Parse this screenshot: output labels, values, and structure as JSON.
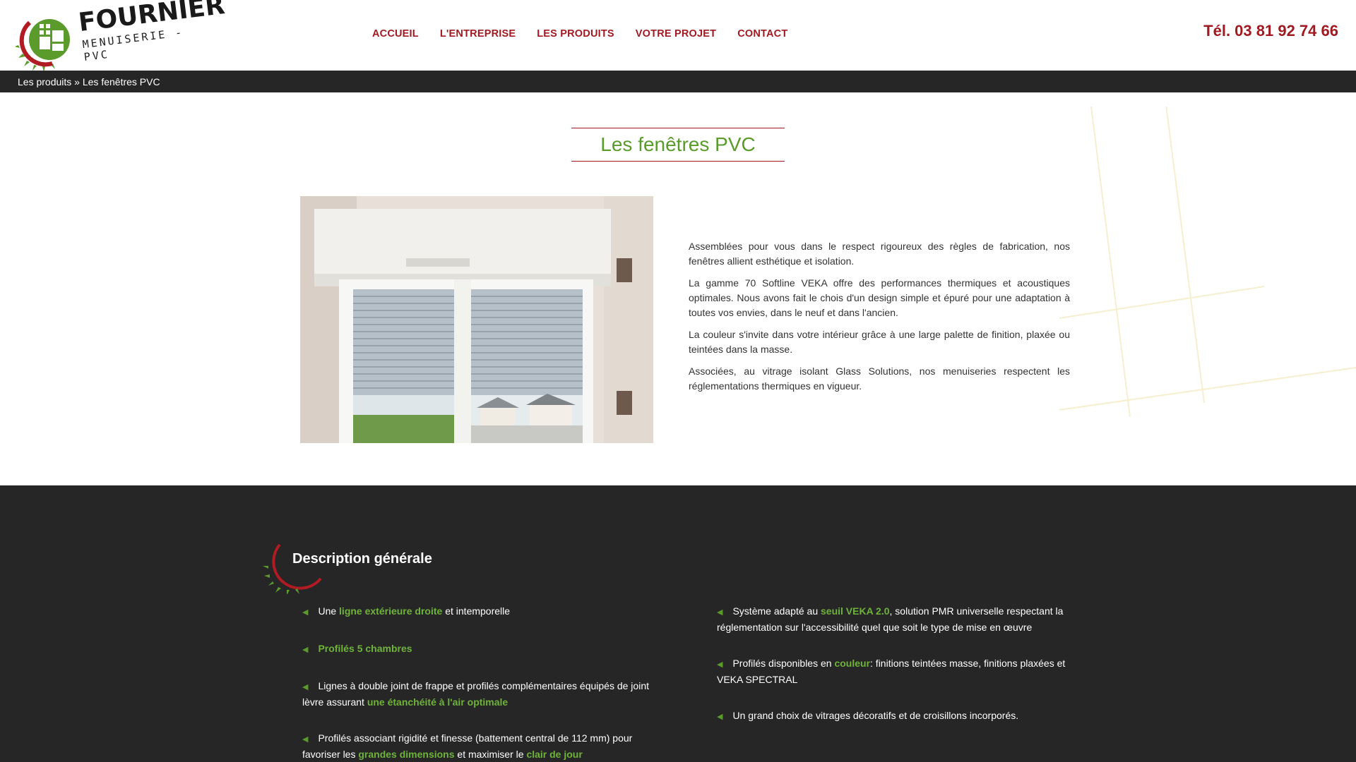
{
  "brand": {
    "name": "FOURNIER",
    "sub": "MENUISERIE - PVC"
  },
  "nav": {
    "items": [
      {
        "label": "ACCUEIL"
      },
      {
        "label": "L'ENTREPRISE"
      },
      {
        "label": "LES PRODUITS"
      },
      {
        "label": "VOTRE PROJET"
      },
      {
        "label": "CONTACT"
      }
    ]
  },
  "phone": "Tél. 03 81 92 74 66",
  "breadcrumb": {
    "parent": "Les produits",
    "separator": " » ",
    "current": "Les fenêtres PVC"
  },
  "page": {
    "title": "Les fenêtres PVC",
    "photo_icon": "window-with-roller-shutters-photo",
    "paragraphs": [
      "Assemblées pour vous dans le respect rigoureux des règles de fabrication, nos fenêtres allient esthétique et isolation.",
      "La gamme 70 Softline VEKA offre des performances thermiques et acoustiques optimales. Nous avons fait le chois d'un design simple et épuré pour une adaptation à toutes vos envies, dans le neuf et dans l'ancien.",
      "La couleur s'invite dans votre intérieur grâce à une large palette de finition, plaxée ou teintées dans la masse.",
      "Associées, au vitrage isolant Glass Solutions, nos menuiseries respectent les réglementations thermiques en vigueur."
    ]
  },
  "description": {
    "title": "Description générale",
    "bullet_icon": "triangle-left-icon",
    "left": [
      {
        "before": "Une ",
        "highlight": "ligne extérieure droite",
        "after": " et intemporelle",
        "highlight2": "",
        "after2": ""
      },
      {
        "before": "",
        "highlight": "Profilés 5 chambres",
        "after": "",
        "highlight2": "",
        "after2": ""
      },
      {
        "before": "Lignes à double joint de frappe et profilés complémentaires équipés de joint lèvre assurant ",
        "highlight": "une étanchéité à l'air optimale",
        "after": "",
        "highlight2": "",
        "after2": ""
      },
      {
        "before": "Profilés associant rigidité et finesse (battement central de 112 mm) pour favoriser les ",
        "highlight": "grandes dimensions",
        "after": " et maximiser le ",
        "highlight2": "clair de jour",
        "after2": ""
      }
    ],
    "right": [
      {
        "before": "Système adapté au ",
        "highlight": "seuil VEKA 2.0",
        "after": ", solution PMR universelle respectant la réglementation sur l'accessibilité quel que soit le type de mise en œuvre",
        "highlight2": "",
        "after2": ""
      },
      {
        "before": "Profilés disponibles en ",
        "highlight": "couleur",
        "after": ": finitions teintées masse, finitions plaxées et VEKA SPECTRAL",
        "highlight2": "",
        "after2": ""
      },
      {
        "before": "Un grand choix de vitrages décoratifs et de croisillons incorporés.",
        "highlight": "",
        "after": "",
        "highlight2": "",
        "after2": ""
      }
    ]
  },
  "colors": {
    "accent_red": "#a01a22",
    "accent_green": "#5a9b2c",
    "dark_bg": "#262626"
  }
}
